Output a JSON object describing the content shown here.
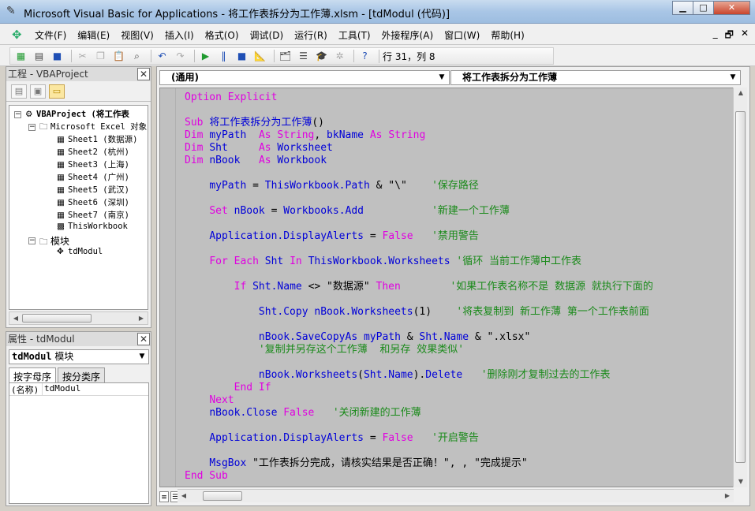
{
  "window": {
    "title": "Microsoft Visual Basic for Applications - 将工作表拆分为工作薄.xlsm - [tdModul (代码)]",
    "min": "▁",
    "max": "□",
    "close": "✕"
  },
  "menu": {
    "items": [
      "文件(F)",
      "编辑(E)",
      "视图(V)",
      "插入(I)",
      "格式(O)",
      "调试(D)",
      "运行(R)",
      "工具(T)",
      "外接程序(A)",
      "窗口(W)",
      "帮助(H)"
    ],
    "mdi_min": "_",
    "mdi_restore": "🗗",
    "mdi_close": "✕"
  },
  "toolbar": {
    "position": "行 31，列 8"
  },
  "project": {
    "title": "工程 - VBAProject",
    "root": "VBAProject (将工作表",
    "excel_objects": "Microsoft Excel 对象",
    "sheets": [
      "Sheet1 (数据源)",
      "Sheet2 (杭州)",
      "Sheet3 (上海)",
      "Sheet4 (广州)",
      "Sheet5 (武汉)",
      "Sheet6 (深圳)",
      "Sheet7 (南京)"
    ],
    "workbook": "ThisWorkbook",
    "modules": "模块",
    "module": "tdModul"
  },
  "properties": {
    "title": "属性 - tdModul",
    "object_name": "tdModul",
    "object_type": "模块",
    "tabs": [
      "按字母序",
      "按分类序"
    ],
    "rows": [
      {
        "key": "(名称)",
        "value": "tdModul"
      }
    ]
  },
  "code_window": {
    "object_combo": "(通用)",
    "proc_combo": "将工作表拆分为工作薄",
    "lines": [
      [
        [
          "kw",
          "Option Explicit"
        ]
      ],
      [],
      [
        [
          "kw",
          "Sub "
        ],
        [
          "ob",
          "将工作表拆分为工作薄"
        ],
        [
          "tx",
          "()"
        ]
      ],
      [
        [
          "kw",
          "Dim "
        ],
        [
          "ob",
          "myPath  "
        ],
        [
          "kw",
          "As String"
        ],
        [
          "tx",
          ", "
        ],
        [
          "ob",
          "bkName "
        ],
        [
          "kw",
          "As String"
        ]
      ],
      [
        [
          "kw",
          "Dim "
        ],
        [
          "ob",
          "Sht     "
        ],
        [
          "kw",
          "As "
        ],
        [
          "ob",
          "Worksheet"
        ]
      ],
      [
        [
          "kw",
          "Dim "
        ],
        [
          "ob",
          "nBook   "
        ],
        [
          "kw",
          "As "
        ],
        [
          "ob",
          "Workbook"
        ]
      ],
      [],
      [
        [
          "tx",
          "    "
        ],
        [
          "ob",
          "myPath "
        ],
        [
          "tx",
          "= "
        ],
        [
          "ob",
          "ThisWorkbook.Path "
        ],
        [
          "tx",
          "& \"\\\"    "
        ],
        [
          "cm",
          "'保存路径"
        ]
      ],
      [],
      [
        [
          "tx",
          "    "
        ],
        [
          "kw",
          "Set "
        ],
        [
          "ob",
          "nBook "
        ],
        [
          "tx",
          "= "
        ],
        [
          "ob",
          "Workbooks.Add           "
        ],
        [
          "cm",
          "'新建一个工作薄"
        ]
      ],
      [],
      [
        [
          "tx",
          "    "
        ],
        [
          "ob",
          "Application.DisplayAlerts "
        ],
        [
          "tx",
          "= "
        ],
        [
          "kw",
          "False   "
        ],
        [
          "cm",
          "'禁用警告"
        ]
      ],
      [],
      [
        [
          "tx",
          "    "
        ],
        [
          "kw",
          "For Each "
        ],
        [
          "ob",
          "Sht "
        ],
        [
          "kw",
          "In "
        ],
        [
          "ob",
          "ThisWorkbook.Worksheets "
        ],
        [
          "cm",
          "'循环 当前工作薄中工作表"
        ]
      ],
      [],
      [
        [
          "tx",
          "        "
        ],
        [
          "kw",
          "If "
        ],
        [
          "ob",
          "Sht.Name "
        ],
        [
          "tx",
          "<> \"数据源\" "
        ],
        [
          "kw",
          "Then        "
        ],
        [
          "cm",
          "'如果工作表名称不是 数据源 就执行下面的"
        ]
      ],
      [],
      [
        [
          "tx",
          "            "
        ],
        [
          "ob",
          "Sht.Copy nBook.Worksheets"
        ],
        [
          "tx",
          "(1)    "
        ],
        [
          "cm",
          "'将表复制到 新工作薄 第一个工作表前面"
        ]
      ],
      [],
      [
        [
          "tx",
          "            "
        ],
        [
          "ob",
          "nBook.SaveCopyAs myPath "
        ],
        [
          "tx",
          "& "
        ],
        [
          "ob",
          "Sht.Name "
        ],
        [
          "tx",
          "& \".xlsx\""
        ]
      ],
      [
        [
          "tx",
          "            "
        ],
        [
          "cm",
          "'复制并另存这个工作薄  和另存 效果类似'"
        ]
      ],
      [],
      [
        [
          "tx",
          "            "
        ],
        [
          "ob",
          "nBook.Worksheets"
        ],
        [
          "tx",
          "("
        ],
        [
          "ob",
          "Sht.Name"
        ],
        [
          "tx",
          ")."
        ],
        [
          "ob",
          "Delete   "
        ],
        [
          "cm",
          "'删除刚才复制过去的工作表"
        ]
      ],
      [
        [
          "tx",
          "        "
        ],
        [
          "kw",
          "End If"
        ]
      ],
      [
        [
          "tx",
          "    "
        ],
        [
          "kw",
          "Next"
        ]
      ],
      [
        [
          "tx",
          "    "
        ],
        [
          "ob",
          "nBook.Close "
        ],
        [
          "kw",
          "False   "
        ],
        [
          "cm",
          "'关闭新建的工作薄"
        ]
      ],
      [],
      [
        [
          "tx",
          "    "
        ],
        [
          "ob",
          "Application.DisplayAlerts "
        ],
        [
          "tx",
          "= "
        ],
        [
          "kw",
          "False   "
        ],
        [
          "cm",
          "'开启警告"
        ]
      ],
      [],
      [
        [
          "tx",
          "    "
        ],
        [
          "ob",
          "MsgBox "
        ],
        [
          "tx",
          "\"工作表拆分完成，请核实结果是否正确！\", , \"完成提示\""
        ]
      ],
      [
        [
          "kw",
          "End Sub"
        ]
      ]
    ]
  },
  "colors": {
    "keyword": "#e000e0",
    "identifier": "#0000d8",
    "comment": "#1a8a1a",
    "editor_bg": "#c0c0c0"
  }
}
